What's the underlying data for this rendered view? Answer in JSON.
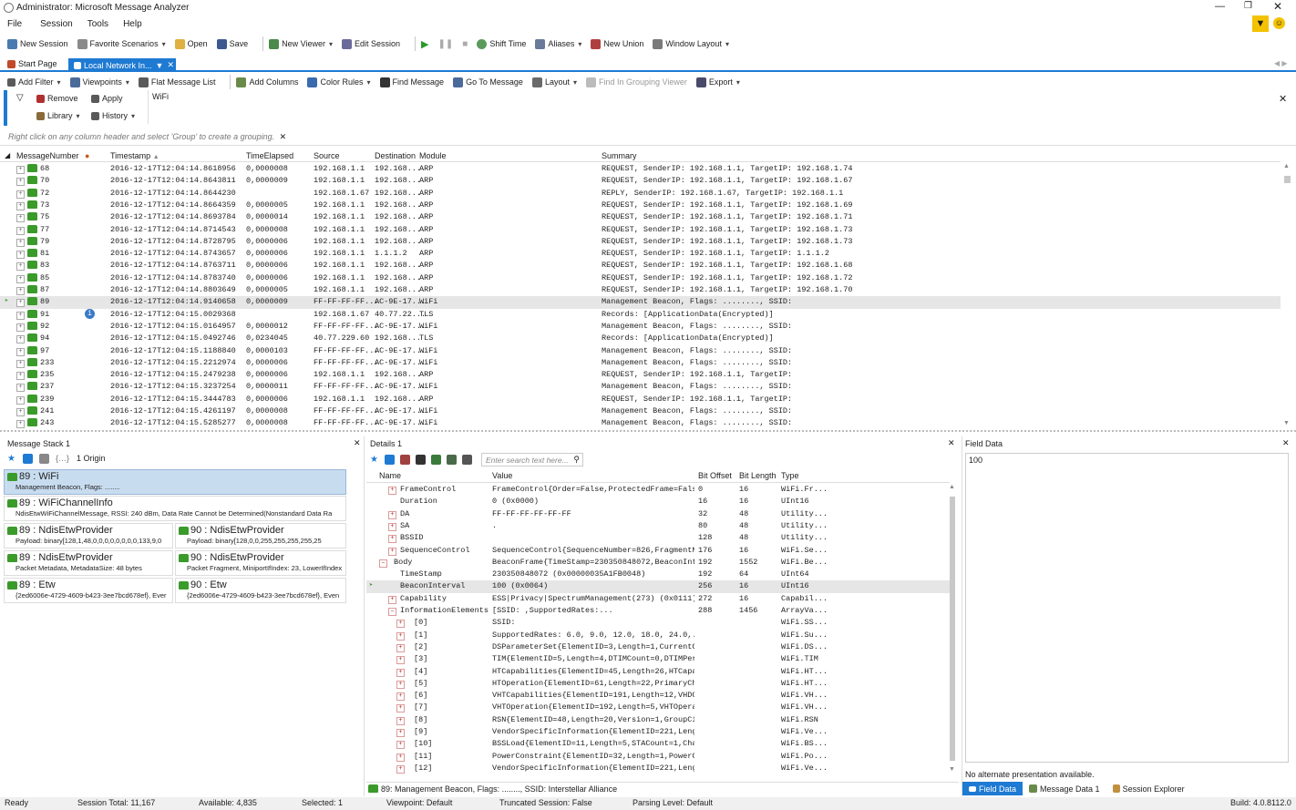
{
  "window": {
    "title": "Administrator: Microsoft Message Analyzer"
  },
  "menu": [
    "File",
    "Session",
    "Tools",
    "Help"
  ],
  "toolbar": [
    "New Session",
    "Favorite Scenarios",
    "Open",
    "Save",
    "New Viewer",
    "Edit Session",
    "Shift Time",
    "Aliases",
    "New Union",
    "Window Layout"
  ],
  "tabs": {
    "start": "Start Page",
    "active": "Local Network In..."
  },
  "viewer_toolbar": [
    "Add Filter",
    "Viewpoints",
    "Flat Message List",
    "Add Columns",
    "Color Rules",
    "Find Message",
    "Go To Message",
    "Layout",
    "Find In Grouping Viewer",
    "Export"
  ],
  "filter": {
    "remove": "Remove",
    "apply": "Apply",
    "library": "Library",
    "history": "History",
    "text": "WiFi"
  },
  "grouping_hint": "Right click on any column header and select 'Group' to create a grouping.",
  "columns": [
    "MessageNumber",
    "Timestamp",
    "TimeElapsed",
    "Source",
    "Destination",
    "Module",
    "Summary"
  ],
  "messages": [
    [
      "68",
      "2016-12-17T12:04:14.8618956",
      "0,0000008",
      "192.168.1.1",
      "192.168...",
      "ARP",
      "REQUEST, SenderIP: 192.168.1.1, TargetIP: 192.168.1.74"
    ],
    [
      "70",
      "2016-12-17T12:04:14.8643811",
      "0,0000009",
      "192.168.1.1",
      "192.168...",
      "ARP",
      "REQUEST, SenderIP: 192.168.1.1, TargetIP: 192.168.1.67"
    ],
    [
      "72",
      "2016-12-17T12:04:14.8644230",
      "",
      "192.168.1.67",
      "192.168...",
      "ARP",
      "REPLY, SenderIP: 192.168.1.67, TargetIP: 192.168.1.1"
    ],
    [
      "73",
      "2016-12-17T12:04:14.8664359",
      "0,0000005",
      "192.168.1.1",
      "192.168...",
      "ARP",
      "REQUEST, SenderIP: 192.168.1.1, TargetIP: 192.168.1.69"
    ],
    [
      "75",
      "2016-12-17T12:04:14.8693784",
      "0,0000014",
      "192.168.1.1",
      "192.168...",
      "ARP",
      "REQUEST, SenderIP: 192.168.1.1, TargetIP: 192.168.1.71"
    ],
    [
      "77",
      "2016-12-17T12:04:14.8714543",
      "0,0000008",
      "192.168.1.1",
      "192.168...",
      "ARP",
      "REQUEST, SenderIP: 192.168.1.1, TargetIP: 192.168.1.73"
    ],
    [
      "79",
      "2016-12-17T12:04:14.8728795",
      "0,0000006",
      "192.168.1.1",
      "192.168...",
      "ARP",
      "REQUEST, SenderIP: 192.168.1.1, TargetIP: 192.168.1.73"
    ],
    [
      "81",
      "2016-12-17T12:04:14.8743657",
      "0,0000006",
      "192.168.1.1",
      "1.1.1.2",
      "ARP",
      "REQUEST, SenderIP: 192.168.1.1, TargetIP: 1.1.1.2"
    ],
    [
      "83",
      "2016-12-17T12:04:14.8763711",
      "0,0000006",
      "192.168.1.1",
      "192.168...",
      "ARP",
      "REQUEST, SenderIP: 192.168.1.1, TargetIP: 192.168.1.68"
    ],
    [
      "85",
      "2016-12-17T12:04:14.8783740",
      "0,0000006",
      "192.168.1.1",
      "192.168...",
      "ARP",
      "REQUEST, SenderIP: 192.168.1.1, TargetIP: 192.168.1.72"
    ],
    [
      "87",
      "2016-12-17T12:04:14.8803649",
      "0,0000005",
      "192.168.1.1",
      "192.168...",
      "ARP",
      "REQUEST, SenderIP: 192.168.1.1, TargetIP: 192.168.1.70"
    ],
    [
      "89",
      "2016-12-17T12:04:14.9140658",
      "0,0000009",
      "FF-FF-FF-FF...",
      "AC-9E-17...",
      "WiFi",
      "Management Beacon, Flags: ........, SSID:"
    ],
    [
      "91",
      "2016-12-17T12:04:15.0029368",
      "",
      "192.168.1.67",
      "40.77.22...",
      "TLS",
      "Records: [ApplicationData(Encrypted)]"
    ],
    [
      "92",
      "2016-12-17T12:04:15.0164957",
      "0,0000012",
      "FF-FF-FF-FF...",
      "AC-9E-17...",
      "WiFi",
      "Management Beacon, Flags: ........, SSID:"
    ],
    [
      "94",
      "2016-12-17T12:04:15.0492746",
      "0,0234045",
      "40.77.229.60",
      "192.168...",
      "TLS",
      "Records: [ApplicationData(Encrypted)]"
    ],
    [
      "97",
      "2016-12-17T12:04:15.1188840",
      "0,0000103",
      "FF-FF-FF-FF...",
      "AC-9E-17...",
      "WiFi",
      "Management Beacon, Flags: ........, SSID:"
    ],
    [
      "233",
      "2016-12-17T12:04:15.2212974",
      "0,0000006",
      "FF-FF-FF-FF...",
      "AC-9E-17...",
      "WiFi",
      "Management Beacon, Flags: ........, SSID:"
    ],
    [
      "235",
      "2016-12-17T12:04:15.2479238",
      "0,0000006",
      "192.168.1.1",
      "192.168...",
      "ARP",
      "REQUEST, SenderIP: 192.168.1.1, TargetIP:"
    ],
    [
      "237",
      "2016-12-17T12:04:15.3237254",
      "0,0000011",
      "FF-FF-FF-FF...",
      "AC-9E-17...",
      "WiFi",
      "Management Beacon, Flags: ........, SSID:"
    ],
    [
      "239",
      "2016-12-17T12:04:15.3444783",
      "0,0000006",
      "192.168.1.1",
      "192.168...",
      "ARP",
      "REQUEST, SenderIP: 192.168.1.1, TargetIP:"
    ],
    [
      "241",
      "2016-12-17T12:04:15.4261197",
      "0,0000008",
      "FF-FF-FF-FF...",
      "AC-9E-17...",
      "WiFi",
      "Management Beacon, Flags: ........, SSID:"
    ],
    [
      "243",
      "2016-12-17T12:04:15.5285277",
      "0,0000008",
      "FF-FF-FF-FF...",
      "AC-9E-17...",
      "WiFi",
      "Management Beacon, Flags: ........, SSID:"
    ]
  ],
  "stack": {
    "title": "Message Stack 1",
    "origin": "1 Origin",
    "items": [
      {
        "t": "89 : WiFi",
        "s": "Management Beacon, Flags: ........"
      },
      {
        "t": "89 : WiFiChannelInfo",
        "s": "NdisEtwWiFiChannelMessage, RSSI: 240 dBm, Data Rate Cannot be Determined(Nonstandard Data Ra"
      },
      {
        "t": "89 : NdisEtwProvider",
        "s": "Payload: binary[128,1,48,0,0,0,0,0,0,0,0,133,9,0"
      },
      {
        "t": "90 : NdisEtwProvider",
        "s": "Payload: binary[128,0,0,255,255,255,255,25"
      },
      {
        "t": "89 : NdisEtwProvider",
        "s": "Packet Metadata, MetadataSize: 48 bytes"
      },
      {
        "t": "90 : NdisEtwProvider",
        "s": "Packet Fragment, MiniportIfIndex: 23, LowerIfIndex"
      },
      {
        "t": "89 : Etw",
        "s": "{2ed6006e-4729-4609-b423-3ee7bcd678ef}, Ever"
      },
      {
        "t": "90 : Etw",
        "s": "{2ed6006e-4729-4609-b423-3ee7bcd678ef}, Even"
      }
    ]
  },
  "details": {
    "title": "Details 1",
    "search_placeholder": "Enter search text here...",
    "columns": [
      "Name",
      "Value",
      "Bit Offset",
      "Bit Length",
      "Type"
    ],
    "rows": [
      [
        "FrameControl",
        "FrameControl{Order=False,ProtectedFrame=Fals...",
        "0",
        "16",
        "WiFi.Fr..."
      ],
      [
        "Duration",
        "0 (0x0000)",
        "16",
        "16",
        "UInt16"
      ],
      [
        "DA",
        "FF-FF-FF-FF-FF-FF",
        "32",
        "48",
        "Utility..."
      ],
      [
        "SA",
        ".",
        "80",
        "48",
        "Utility..."
      ],
      [
        "BSSID",
        "",
        "128",
        "48",
        "Utility..."
      ],
      [
        "SequenceControl",
        "SequenceControl{SequenceNumber=826,FragmentN...",
        "176",
        "16",
        "WiFi.Se..."
      ],
      [
        "Body",
        "BeaconFrame{TimeStamp=230350848072,BeaconInt...",
        "192",
        "1552",
        "WiFi.Be..."
      ],
      [
        "TimeStamp",
        "230350848072 (0x00000035A1FB0048)",
        "192",
        "64",
        "UInt64"
      ],
      [
        "BeaconInterval",
        "100 (0x0064)",
        "256",
        "16",
        "UInt16"
      ],
      [
        "Capability",
        "ESS|Privacy|SpectrumManagement(273) (0x0111)",
        "272",
        "16",
        "Capabil..."
      ],
      [
        "InformationElements",
        "[SSID:                    ,SupportedRates:...",
        "288",
        "1456",
        "ArrayVa..."
      ],
      [
        "[0]",
        "SSID:",
        "",
        "",
        "WiFi.SS..."
      ],
      [
        "[1]",
        "SupportedRates: 6.0, 9.0, 12.0, 18.0, 24.0,...",
        "",
        "",
        "WiFi.Su..."
      ],
      [
        "[2]",
        "DSParameterSet{ElementID=3,Length=1,CurrentC...",
        "",
        "",
        "WiFi.DS..."
      ],
      [
        "[3]",
        "TIM{ElementID=5,Length=4,DTIMCount=0,DTIMPer...",
        "",
        "",
        "WiFi.TIM"
      ],
      [
        "[4]",
        "HTCapabilities{ElementID=45,Length=26,HTCapa...",
        "",
        "",
        "WiFi.HT..."
      ],
      [
        "[5]",
        "HTOperation{ElementID=61,Length=22,PrimaryCh...",
        "",
        "",
        "WiFi.HT..."
      ],
      [
        "[6]",
        "VHTCapabilities{ElementID=191,Length=12,VHDC...",
        "",
        "",
        "WiFi.VH..."
      ],
      [
        "[7]",
        "VHTOperation{ElementID=192,Length=5,VHTOpera...",
        "",
        "",
        "WiFi.VH..."
      ],
      [
        "[8]",
        "RSN{ElementID=48,Length=20,Version=1,GroupCi...",
        "",
        "",
        "WiFi.RSN"
      ],
      [
        "[9]",
        "VendorSpecificInformation{ElementID=221,Leng...",
        "",
        "",
        "WiFi.Ve..."
      ],
      [
        "[10]",
        "BSSLoad{ElementID=11,Length=5,STACount=1,Cha...",
        "",
        "",
        "WiFi.BS..."
      ],
      [
        "[11]",
        "PowerConstraint{ElementID=32,Length=1,PowerC...",
        "",
        "",
        "WiFi.Po..."
      ],
      [
        "[12]",
        "VendorSpecificInformation{ElementID=221,Leng...",
        "",
        "",
        "WiFi.Ve..."
      ]
    ],
    "footer": "89: Management Beacon, Flags: ........, SSID: Interstellar Alliance"
  },
  "field": {
    "title": "Field Data",
    "value": "100",
    "alt": "No alternate presentation available.",
    "tabs": [
      "Field Data",
      "Message Data 1",
      "Session Explorer"
    ]
  },
  "status": {
    "ready": "Ready",
    "total": "Session Total: 11,167",
    "available": "Available: 4,835",
    "selected": "Selected: 1",
    "viewpoint": "Viewpoint: Default",
    "truncated": "Truncated Session: False",
    "parsing": "Parsing Level: Default",
    "build": "Build: 4.0.8112.0"
  }
}
